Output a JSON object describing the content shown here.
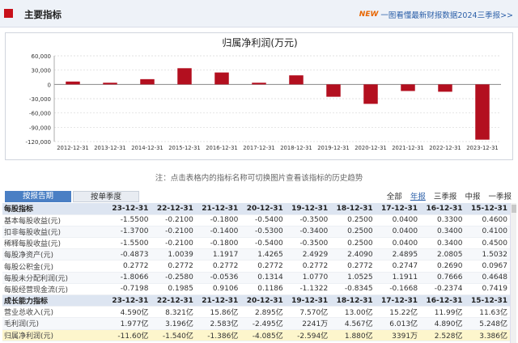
{
  "header": {
    "title": "主要指标",
    "promo_badge": "NEW",
    "promo_text": "一图看懂最新财报数据2024三季报>>"
  },
  "chart_data": {
    "type": "bar",
    "title": "归属净利润(万元)",
    "categories": [
      "2012-12-31",
      "2013-12-31",
      "2014-12-31",
      "2015-12-31",
      "2016-12-31",
      "2017-12-31",
      "2018-12-31",
      "2019-12-31",
      "2020-12-31",
      "2021-12-31",
      "2022-12-31",
      "2023-12-31"
    ],
    "values": [
      6000,
      3500,
      11000,
      34000,
      25000,
      3500,
      19000,
      -25940,
      -40850,
      -13860,
      -15400,
      -116000
    ],
    "ylim": [
      -120000,
      60000
    ],
    "yticks": [
      60000,
      30000,
      0,
      -30000,
      -60000,
      -90000,
      -120000
    ],
    "ytick_labels": [
      "60,000",
      "30,000",
      "0",
      "-30,000",
      "-60,000",
      "-90,000",
      "-120,000"
    ],
    "grid": true,
    "bar_color": "#b30f1f"
  },
  "note": "注：点击表格内的指标名称可切换图片查看该指标的历史趋势",
  "tabs": {
    "active": "按报告期",
    "inactive": "按单季度"
  },
  "periods": [
    "全部",
    "年报",
    "三季报",
    "中报",
    "一季报"
  ],
  "periods_active": "年报",
  "table": {
    "sections": [
      {
        "title": "每股指标",
        "columns": [
          "23-12-31",
          "22-12-31",
          "21-12-31",
          "20-12-31",
          "19-12-31",
          "18-12-31",
          "17-12-31",
          "16-12-31",
          "15-12-31"
        ],
        "rows": [
          {
            "label": "基本每股收益(元)",
            "values": [
              "-1.5500",
              "-0.2100",
              "-0.1800",
              "-0.5400",
              "-0.3500",
              "0.2500",
              "0.0400",
              "0.3300",
              "0.4600"
            ]
          },
          {
            "label": "扣非每股收益(元)",
            "values": [
              "-1.3700",
              "-0.2100",
              "-0.1400",
              "-0.5300",
              "-0.3400",
              "0.2500",
              "0.0400",
              "0.3400",
              "0.4100"
            ]
          },
          {
            "label": "稀释每股收益(元)",
            "values": [
              "-1.5500",
              "-0.2100",
              "-0.1800",
              "-0.5400",
              "-0.3500",
              "0.2500",
              "0.0400",
              "0.3400",
              "0.4500"
            ]
          },
          {
            "label": "每股净资产(元)",
            "values": [
              "-0.4873",
              "1.0039",
              "1.1917",
              "1.4265",
              "2.4929",
              "2.4090",
              "2.4895",
              "2.0805",
              "1.5032"
            ]
          },
          {
            "label": "每股公积金(元)",
            "values": [
              "0.2772",
              "0.2772",
              "0.2772",
              "0.2772",
              "0.2772",
              "0.2772",
              "0.2747",
              "0.2690",
              "0.0967"
            ]
          },
          {
            "label": "每股未分配利润(元)",
            "values": [
              "-1.8066",
              "-0.2580",
              "-0.0536",
              "0.1314",
              "1.0770",
              "1.0525",
              "1.1911",
              "0.7666",
              "0.4648"
            ]
          },
          {
            "label": "每股经营现金流(元)",
            "values": [
              "-0.7198",
              "0.1985",
              "0.9106",
              "0.1186",
              "-1.1322",
              "-0.8345",
              "-0.1668",
              "-0.2374",
              "0.7419"
            ]
          }
        ]
      },
      {
        "title": "成长能力指标",
        "columns": [
          "23-12-31",
          "22-12-31",
          "21-12-31",
          "20-12-31",
          "19-12-31",
          "18-12-31",
          "17-12-31",
          "16-12-31",
          "15-12-31"
        ],
        "rows": [
          {
            "label": "营业总收入(元)",
            "values": [
              "4.590亿",
              "8.321亿",
              "15.86亿",
              "2.895亿",
              "7.570亿",
              "13.00亿",
              "15.22亿",
              "11.99亿",
              "11.63亿"
            ]
          },
          {
            "label": "毛利润(元)",
            "values": [
              "1.977亿",
              "3.196亿",
              "2.583亿",
              "-2.495亿",
              "2241万",
              "4.567亿",
              "6.013亿",
              "4.890亿",
              "5.248亿"
            ]
          },
          {
            "label": "归属净利润(元)",
            "values": [
              "-11.60亿",
              "-1.540亿",
              "-1.386亿",
              "-4.085亿",
              "-2.594亿",
              "1.880亿",
              "3391万",
              "2.528亿",
              "3.386亿"
            ],
            "highlight": true
          }
        ]
      }
    ]
  }
}
